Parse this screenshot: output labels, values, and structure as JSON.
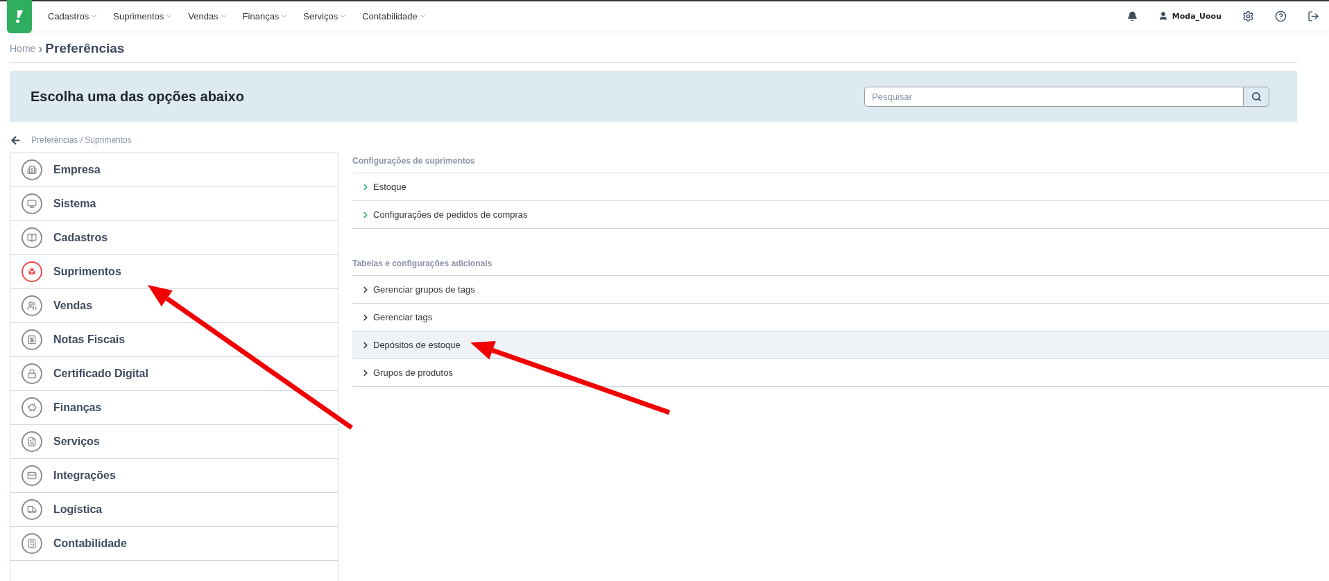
{
  "topbar": {
    "menu": [
      {
        "label": "Cadastros"
      },
      {
        "label": "Suprimentos"
      },
      {
        "label": "Vendas"
      },
      {
        "label": "Finanças"
      },
      {
        "label": "Serviços"
      },
      {
        "label": "Contabilidade"
      }
    ],
    "user": "Moda_Uoou"
  },
  "breadcrumb": {
    "home": "Home",
    "separator": "›",
    "current": "Preferências"
  },
  "banner": {
    "title": "Escolha uma das opções abaixo",
    "search": {
      "placeholder": "Pesquisar"
    }
  },
  "path": "Preferências / Suprimentos",
  "sidebar": {
    "items": [
      {
        "label": "Empresa",
        "selected": false
      },
      {
        "label": "Sistema",
        "selected": false
      },
      {
        "label": "Cadastros",
        "selected": false
      },
      {
        "label": "Suprimentos",
        "selected": true
      },
      {
        "label": "Vendas",
        "selected": false
      },
      {
        "label": "Notas Fiscais",
        "selected": false
      },
      {
        "label": "Certificado Digital",
        "selected": false
      },
      {
        "label": "Finanças",
        "selected": false
      },
      {
        "label": "Serviços",
        "selected": false
      },
      {
        "label": "Integrações",
        "selected": false
      },
      {
        "label": "Logística",
        "selected": false
      },
      {
        "label": "Contabilidade",
        "selected": false
      }
    ]
  },
  "sections": [
    {
      "title": "Configurações de suprimentos",
      "items": [
        {
          "label": "Estoque",
          "color": "#27ae60",
          "highlighted": false
        },
        {
          "label": "Configurações de pedidos de compras",
          "color": "#27ae60",
          "highlighted": false
        }
      ]
    },
    {
      "title": "Tabelas e configurações adicionais",
      "items": [
        {
          "label": "Gerenciar grupos de tags",
          "color": "#333333",
          "highlighted": false
        },
        {
          "label": "Gerenciar tags",
          "color": "#333333",
          "highlighted": false
        },
        {
          "label": "Depósitos de estoque",
          "color": "#333333",
          "highlighted": true
        },
        {
          "label": "Grupos de produtos",
          "color": "#333333",
          "highlighted": false
        }
      ]
    }
  ]
}
